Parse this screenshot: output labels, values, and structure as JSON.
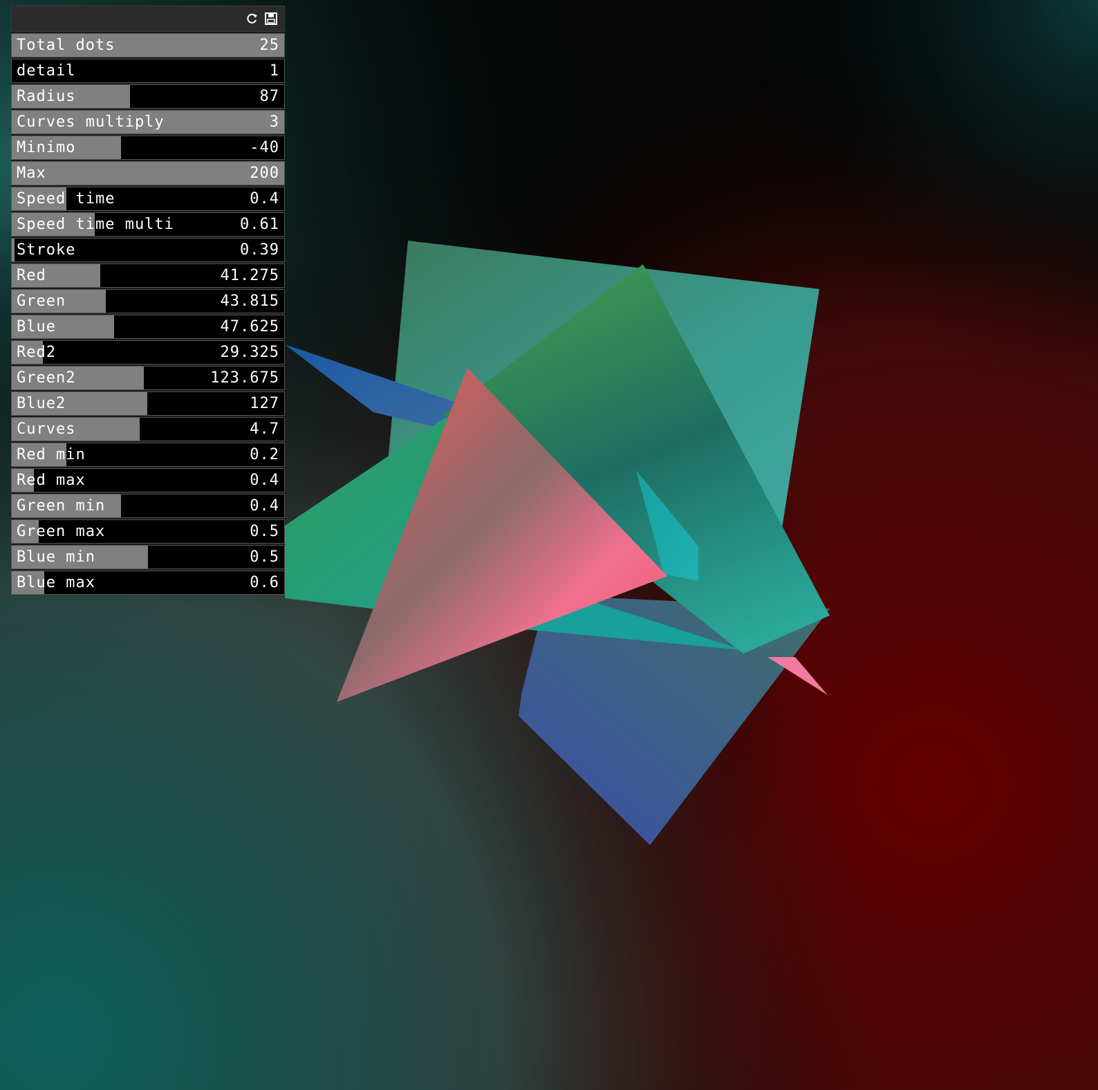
{
  "gui": {
    "header_icons": [
      "refresh-icon",
      "save-icon"
    ],
    "sliders": [
      {
        "label": "Total dots",
        "value": "25",
        "fill": 1.0
      },
      {
        "label": "detail",
        "value": "1",
        "fill": 0.0
      },
      {
        "label": "Radius",
        "value": "87",
        "fill": 0.435
      },
      {
        "label": "Curves multiply",
        "value": "3",
        "fill": 1.0
      },
      {
        "label": "Minimo",
        "value": "-40",
        "fill": 0.4
      },
      {
        "label": "Max",
        "value": "200",
        "fill": 1.0
      },
      {
        "label": "Speed time",
        "value": "0.4",
        "fill": 0.2
      },
      {
        "label": "Speed time multi",
        "value": "0.61",
        "fill": 0.305
      },
      {
        "label": "Stroke",
        "value": "0.39",
        "fill": 0.01
      },
      {
        "label": "Red",
        "value": "41.275",
        "fill": 0.325
      },
      {
        "label": "Green",
        "value": "43.815",
        "fill": 0.345
      },
      {
        "label": "Blue",
        "value": "47.625",
        "fill": 0.375
      },
      {
        "label": "Red2",
        "value": "29.325",
        "fill": 0.115
      },
      {
        "label": "Green2",
        "value": "123.675",
        "fill": 0.485
      },
      {
        "label": "Blue2",
        "value": "127",
        "fill": 0.498
      },
      {
        "label": "Curves",
        "value": "4.7",
        "fill": 0.47
      },
      {
        "label": "Red min",
        "value": "0.2",
        "fill": 0.2
      },
      {
        "label": "Red max",
        "value": "0.4",
        "fill": 0.08
      },
      {
        "label": "Green min",
        "value": "0.4",
        "fill": 0.4
      },
      {
        "label": "Green max",
        "value": "0.5",
        "fill": 0.1
      },
      {
        "label": "Blue min",
        "value": "0.5",
        "fill": 0.5
      },
      {
        "label": "Blue max",
        "value": "0.6",
        "fill": 0.12
      }
    ]
  },
  "colors": {
    "panel_bg": "#000000",
    "slider_fill": "#808080",
    "text": "#ffffff",
    "bg_teal": "#0b5a55",
    "bg_red": "#5c0000",
    "shape_green": "#3a8a60",
    "shape_pink": "#f06070",
    "shape_blue": "#3a55a0",
    "shape_teal": "#1aa0a0"
  }
}
